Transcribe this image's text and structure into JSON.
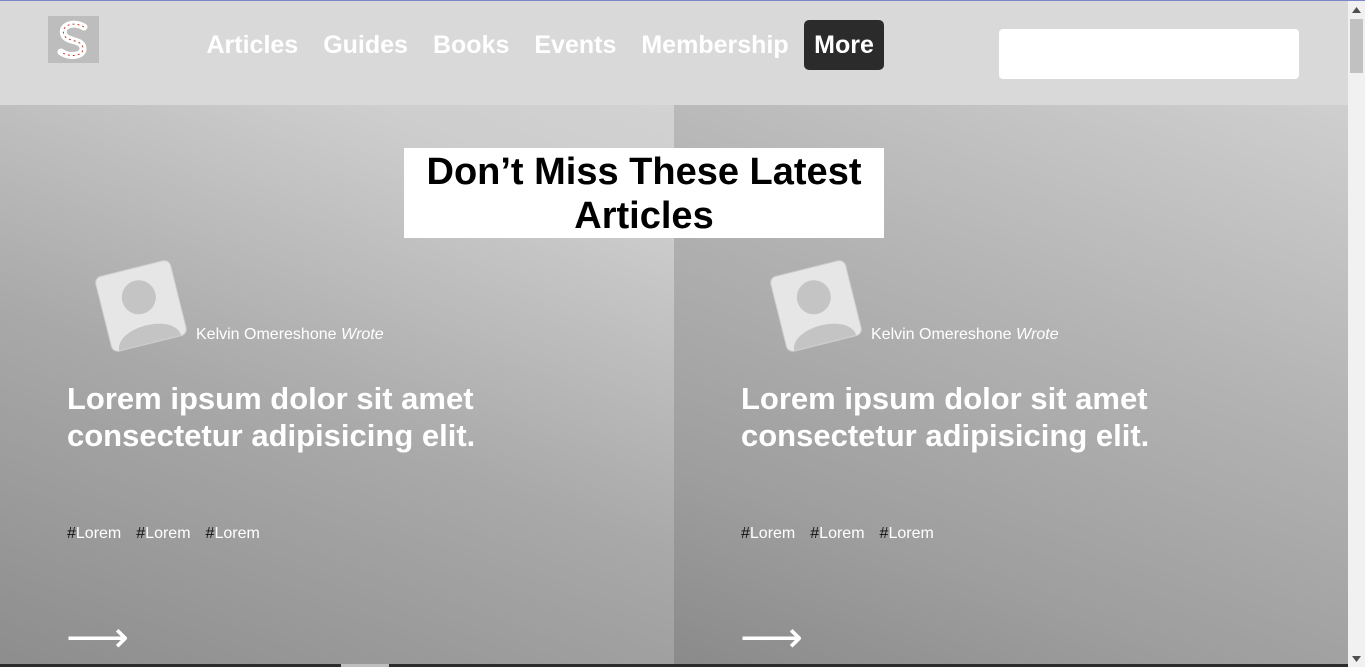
{
  "nav": {
    "items": [
      {
        "label": "Articles"
      },
      {
        "label": "Guides"
      },
      {
        "label": "Books"
      },
      {
        "label": "Events"
      },
      {
        "label": "Membership"
      },
      {
        "label": "More",
        "active": true
      }
    ]
  },
  "search": {
    "value": "",
    "placeholder": ""
  },
  "headline": "Don’t Miss These Latest Articles",
  "articles": [
    {
      "author": "Kelvin Omereshone",
      "author_suffix": "Wrote",
      "title": "Lorem ipsum dolor sit amet consectetur adipisicing elit.",
      "tags": [
        "Lorem",
        "Lorem",
        "Lorem"
      ],
      "arrow": "⟶"
    },
    {
      "author": "Kelvin Omereshone",
      "author_suffix": "Wrote",
      "title": "Lorem ipsum dolor sit amet consectetur adipisicing elit.",
      "tags": [
        "Lorem",
        "Lorem",
        "Lorem"
      ],
      "arrow": "⟶"
    }
  ],
  "tag_prefix": "#",
  "colors": {
    "header_bg": "#d9d9d9",
    "active_nav_bg": "#2b2b2b",
    "text_light": "#ffffff"
  },
  "icons": {
    "logo": "site-logo-icon",
    "avatar": "user-avatar-icon",
    "arrow": "arrow-right-icon"
  }
}
